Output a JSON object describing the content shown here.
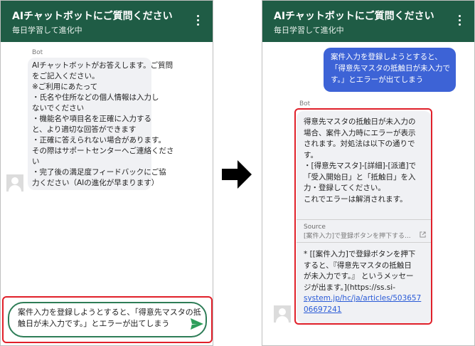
{
  "header": {
    "title": "AIチャットボットにご質問ください",
    "subtitle": "毎日学習して進化中"
  },
  "left": {
    "bot_label": "Bot",
    "welcome_lines": [
      "AIチャットボットがお答えします。ご質問",
      "をご記入ください。",
      "※ご利用にあたって",
      "・氏名や住所などの個人情報は入力し",
      "ないでください",
      "・機能名や項目名を正確に入力する",
      "と、より適切な回答ができます",
      "・正確に答えられない場合があります。",
      "その際はサポートセンターへご連絡くださ",
      "い",
      "・完了後の満足度フィードバックにご協",
      "力ください（AIの進化が早まります）"
    ],
    "input_lines": [
      "案件入力を登録しようとすると、「得意先マスタの抵",
      "触日が未入力です。」とエラーが出てしまう"
    ]
  },
  "right": {
    "user_lines": [
      "案件入力を登録しようとすると、",
      "「得意先マスタの抵触日が未入力で",
      "す。」とエラーが出てしまう"
    ],
    "bot_label": "Bot",
    "answer_lines": [
      "得意先マスタの抵触日が未入力の",
      "場合、案件入力時にエラーが表示",
      "されます。対処法は以下の通りで",
      "す。",
      "・[得意先マスタ]-[詳細]-[派遣]で",
      "「受入開始日」と「抵触日」を入",
      "力・登録してください。",
      "これでエラーは解消されます。"
    ],
    "source_label": "Source",
    "source_link": "[案件入力]で登録ボタンを押下する...",
    "source_text_lines": [
      "* [[案件入力]で登録ボタンを押下",
      "すると、『得意先マスタの抵触日",
      "が未入力です。』 というメッセー",
      "ジが出ます。](https://ss.si-",
      "system.jp/hc/ja/articles/503657",
      "06697241"
    ]
  },
  "colors": {
    "header": "#1f5c45",
    "user_bubble": "#3d63d6",
    "highlight": "#e0202a",
    "send": "#2e9e5b"
  }
}
